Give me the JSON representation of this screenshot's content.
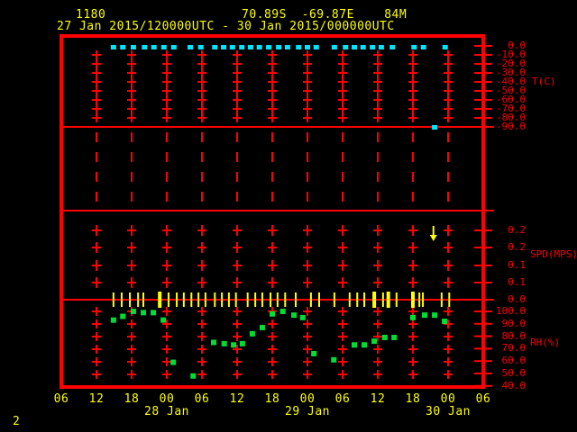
{
  "header": {
    "station_id": "1180",
    "position": "70.89S  -69.87E    84M",
    "time_range": "27 Jan 2015/120000UTC - 30 Jan 2015/000000UTC"
  },
  "page": {
    "number": "2"
  },
  "colors": {
    "frame": "#ff0000",
    "grid": "#ff0000",
    "axis_text": "#ff0000",
    "header_text": "#ffff00",
    "hour_text": "#ffff00",
    "temp_marker": "#00e6ff",
    "rh_marker": "#00dd33",
    "wind_marker": "#ffff00",
    "background": "#000000"
  },
  "chart_data": {
    "type": "scatter",
    "title": "1180  70.89S -69.87E 84M  27 Jan 2015/120000UTC - 30 Jan 2015/000000UTC",
    "x_axis": {
      "unit": "hours UTC, from 06Z 27 Jan to 06Z 30 Jan",
      "hours_start": 6,
      "hours_end": 78,
      "tick_step_hours": 6,
      "tick_labels": [
        "06",
        "12",
        "18",
        "00",
        "06",
        "12",
        "18",
        "00",
        "06",
        "12",
        "18",
        "00",
        "06"
      ],
      "date_labels": [
        {
          "label": "28 Jan",
          "hour": 24
        },
        {
          "label": "29 Jan",
          "hour": 48
        },
        {
          "label": "30 Jan",
          "hour": 72
        }
      ]
    },
    "panels": [
      {
        "id": "temperature",
        "ylabel": "T(C)",
        "tick_labels": [
          "0.0",
          "-10.0",
          "-20.0",
          "-30.0",
          "-40.0",
          "-50.0",
          "-60.0",
          "-70.0",
          "-80.0",
          "-90.0"
        ],
        "ylim": [
          0,
          -90
        ],
        "grid": "cross-ticks"
      },
      {
        "id": "spacer",
        "ylabel": "",
        "tick_labels": [],
        "grid": "dashed-vertical"
      },
      {
        "id": "wind_speed",
        "ylabel": "SPD(MPS)",
        "tick_labels": [
          "0.2",
          "0.2",
          "0.1",
          "0.1",
          "0.0"
        ],
        "ylim": [
          0.25,
          0.0
        ],
        "grid": "cross-ticks"
      },
      {
        "id": "relative_humidity",
        "ylabel": "RH(%)",
        "tick_labels": [
          "100.0",
          "90.0",
          "80.0",
          "70.0",
          "60.0",
          "50.0",
          "40.0"
        ],
        "ylim": [
          100,
          40
        ],
        "grid": "cross-ticks"
      }
    ],
    "series": [
      {
        "name": "temperature_c",
        "marker": "square",
        "color_key": "temp_marker",
        "points": [
          [
            14.9,
            -1
          ],
          [
            16.5,
            -1
          ],
          [
            18.3,
            -1
          ],
          [
            20.2,
            -1
          ],
          [
            21.8,
            -1
          ],
          [
            23.5,
            -1
          ],
          [
            25.2,
            -1
          ],
          [
            28.0,
            -1
          ],
          [
            29.8,
            -1
          ],
          [
            32.2,
            -1
          ],
          [
            33.7,
            -1
          ],
          [
            35.2,
            -1
          ],
          [
            36.8,
            -1
          ],
          [
            38.3,
            -1
          ],
          [
            39.8,
            -1
          ],
          [
            41.4,
            -1
          ],
          [
            43.1,
            -1
          ],
          [
            44.6,
            -1
          ],
          [
            46.5,
            -1
          ],
          [
            48.0,
            -1
          ],
          [
            49.5,
            -1
          ],
          [
            52.6,
            -1
          ],
          [
            54.5,
            -1
          ],
          [
            56.0,
            -1
          ],
          [
            57.5,
            -1
          ],
          [
            59.1,
            -1
          ],
          [
            60.6,
            -1
          ],
          [
            62.5,
            -1
          ],
          [
            66.2,
            -1
          ],
          [
            67.8,
            -1
          ],
          [
            71.5,
            -1
          ],
          [
            69.7,
            -90
          ]
        ]
      },
      {
        "name": "rh_percent",
        "marker": "square",
        "color_key": "rh_marker",
        "points": [
          [
            14.9,
            93
          ],
          [
            16.5,
            96
          ],
          [
            18.3,
            100
          ],
          [
            20.0,
            99
          ],
          [
            21.7,
            99
          ],
          [
            23.4,
            93
          ],
          [
            25.1,
            59
          ],
          [
            28.5,
            48
          ],
          [
            32.0,
            75
          ],
          [
            33.8,
            74
          ],
          [
            35.4,
            73
          ],
          [
            36.9,
            74
          ],
          [
            38.6,
            82
          ],
          [
            40.3,
            87
          ],
          [
            42.0,
            98
          ],
          [
            43.8,
            100
          ],
          [
            45.7,
            97
          ],
          [
            47.2,
            95
          ],
          [
            49.1,
            66
          ],
          [
            52.5,
            61
          ],
          [
            56.0,
            73
          ],
          [
            57.7,
            73
          ],
          [
            59.4,
            76
          ],
          [
            61.2,
            79
          ],
          [
            62.8,
            79
          ],
          [
            66.0,
            95
          ],
          [
            68.0,
            97
          ],
          [
            69.7,
            97
          ],
          [
            71.4,
            92
          ]
        ]
      },
      {
        "name": "wind_staff_ticks",
        "marker": "vertical-bar",
        "color_key": "wind_marker",
        "hours": [
          14.9,
          16.3,
          17.7,
          19.1,
          20.0,
          22.8,
          24.3,
          25.7,
          26.9,
          28.2,
          29.4,
          30.6,
          32.2,
          33.4,
          34.6,
          35.8,
          37.8,
          39.1,
          40.3,
          41.7,
          42.9,
          44.2,
          46.0,
          48.6,
          50.0,
          52.6,
          55.2,
          56.5,
          57.7,
          59.4,
          60.9,
          61.8,
          63.2,
          66.0,
          67.1,
          67.7,
          70.9,
          72.2
        ],
        "thick_hours": [
          22.8,
          59.4,
          61.8,
          66.0
        ]
      },
      {
        "name": "wind_arrow_down",
        "marker": "down-arrow",
        "color_key": "wind_marker",
        "hour": 69.5
      }
    ]
  }
}
